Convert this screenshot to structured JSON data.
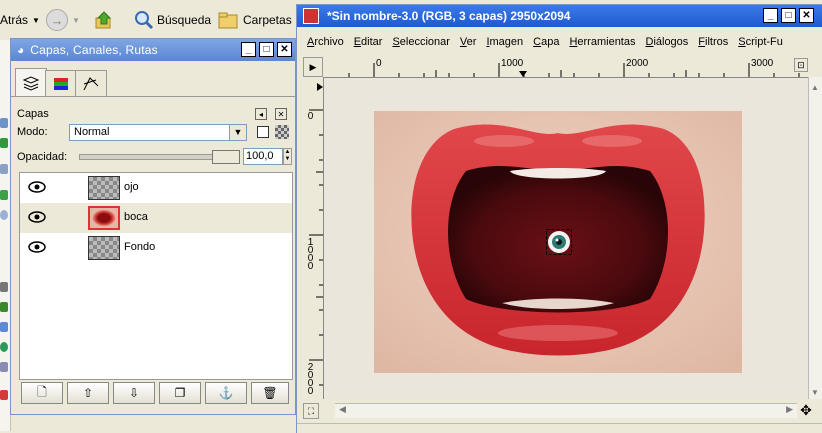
{
  "explorer": {
    "back_label": "Atrás",
    "search_label": "Búsqueda",
    "folders_label": "Carpetas"
  },
  "layers_dialog": {
    "title": "Capas, Canales, Rutas",
    "panel_label": "Capas",
    "mode_label": "Modo:",
    "mode_value": "Normal",
    "opacity_label": "Opacidad:",
    "opacity_value": "100,0",
    "opacity_fraction": 1.0,
    "layers": [
      {
        "name": "ojo",
        "thumb": "transparent",
        "selected": false
      },
      {
        "name": "boca",
        "thumb": "mouth",
        "selected": true
      },
      {
        "name": "Fondo",
        "thumb": "transparent",
        "selected": false
      }
    ]
  },
  "image_window": {
    "title": "*Sin nombre-3.0 (RGB, 3 capas) 2950x2094",
    "menus": [
      {
        "label": "Archivo",
        "key": "A"
      },
      {
        "label": "Editar",
        "key": "E"
      },
      {
        "label": "Seleccionar",
        "key": "S"
      },
      {
        "label": "Ver",
        "key": "V"
      },
      {
        "label": "Imagen",
        "key": "I"
      },
      {
        "label": "Capa",
        "key": "C"
      },
      {
        "label": "Herramientas",
        "key": "H"
      },
      {
        "label": "Diálogos",
        "key": "D"
      },
      {
        "label": "Filtros",
        "key": "F"
      },
      {
        "label": "Script-Fu",
        "key": "S"
      }
    ],
    "ruler_top_labels": [
      "0",
      "1000",
      "2000",
      "3000"
    ],
    "ruler_left_labels": [
      "0",
      "1000",
      "2000"
    ]
  },
  "colors": {
    "title_bar": "#5a86d4",
    "lip_red": "#d9353a",
    "skin": "#eac9b8"
  }
}
